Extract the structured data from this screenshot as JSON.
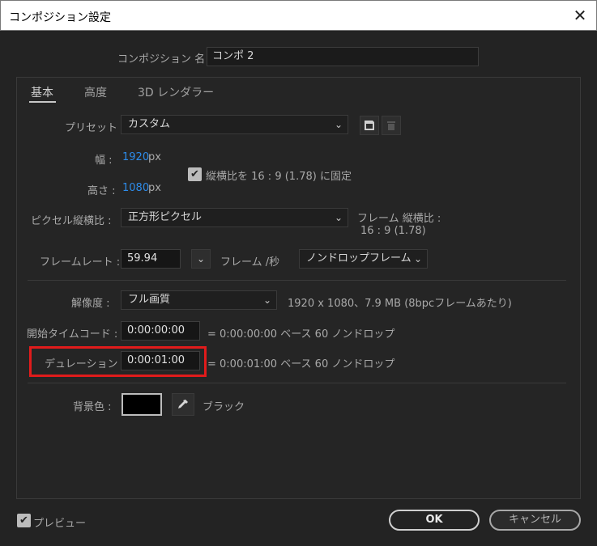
{
  "window": {
    "title": "コンポジション設定",
    "close_glyph": "✕"
  },
  "comp_name": {
    "label": "コンポジション 名 :",
    "value": "コンポ 2"
  },
  "tabs": [
    {
      "label": "基本"
    },
    {
      "label": "高度"
    },
    {
      "label": "3D レンダラー"
    }
  ],
  "preset": {
    "label": "プリセット :",
    "value": "カスタム"
  },
  "width": {
    "label": "幅 :",
    "value": "1920",
    "unit": "px"
  },
  "height": {
    "label": "高さ :",
    "value": "1080",
    "unit": "px"
  },
  "lock_aspect": {
    "checked": true,
    "label": "縦横比を 16 : 9 (1.78) に固定"
  },
  "pixel_aspect": {
    "label": "ピクセル縦横比 :",
    "value": "正方形ピクセル"
  },
  "frame_aspect": {
    "label": "フレーム 縦横比 :",
    "value": "16 : 9 (1.78)"
  },
  "frame_rate": {
    "label": "フレームレート :",
    "value": "59.94",
    "unit": "フレーム /秒",
    "drop_value": "ノンドロップフレーム"
  },
  "resolution": {
    "label": "解像度 :",
    "value": "フル画質",
    "info": "1920 x 1080、7.9 MB (8bpcフレームあたり)"
  },
  "start_timecode": {
    "label": "開始タイムコード :",
    "value": "0:00:00:00",
    "info": "= 0:00:00:00  ベース 60  ノンドロップ"
  },
  "duration": {
    "label": "デュレーション :",
    "value": "0:00:01:00",
    "info": "= 0:00:01:00  ベース 60  ノンドロップ"
  },
  "background": {
    "label": "背景色 :",
    "color": "#000000",
    "name": "ブラック"
  },
  "preview": {
    "checked": true,
    "label": "プレビュー"
  },
  "buttons": {
    "ok": "OK",
    "cancel": "キャンセル"
  },
  "colors": {
    "accent_blue": "#2d8ceb",
    "highlight_red": "#e01b1b"
  }
}
